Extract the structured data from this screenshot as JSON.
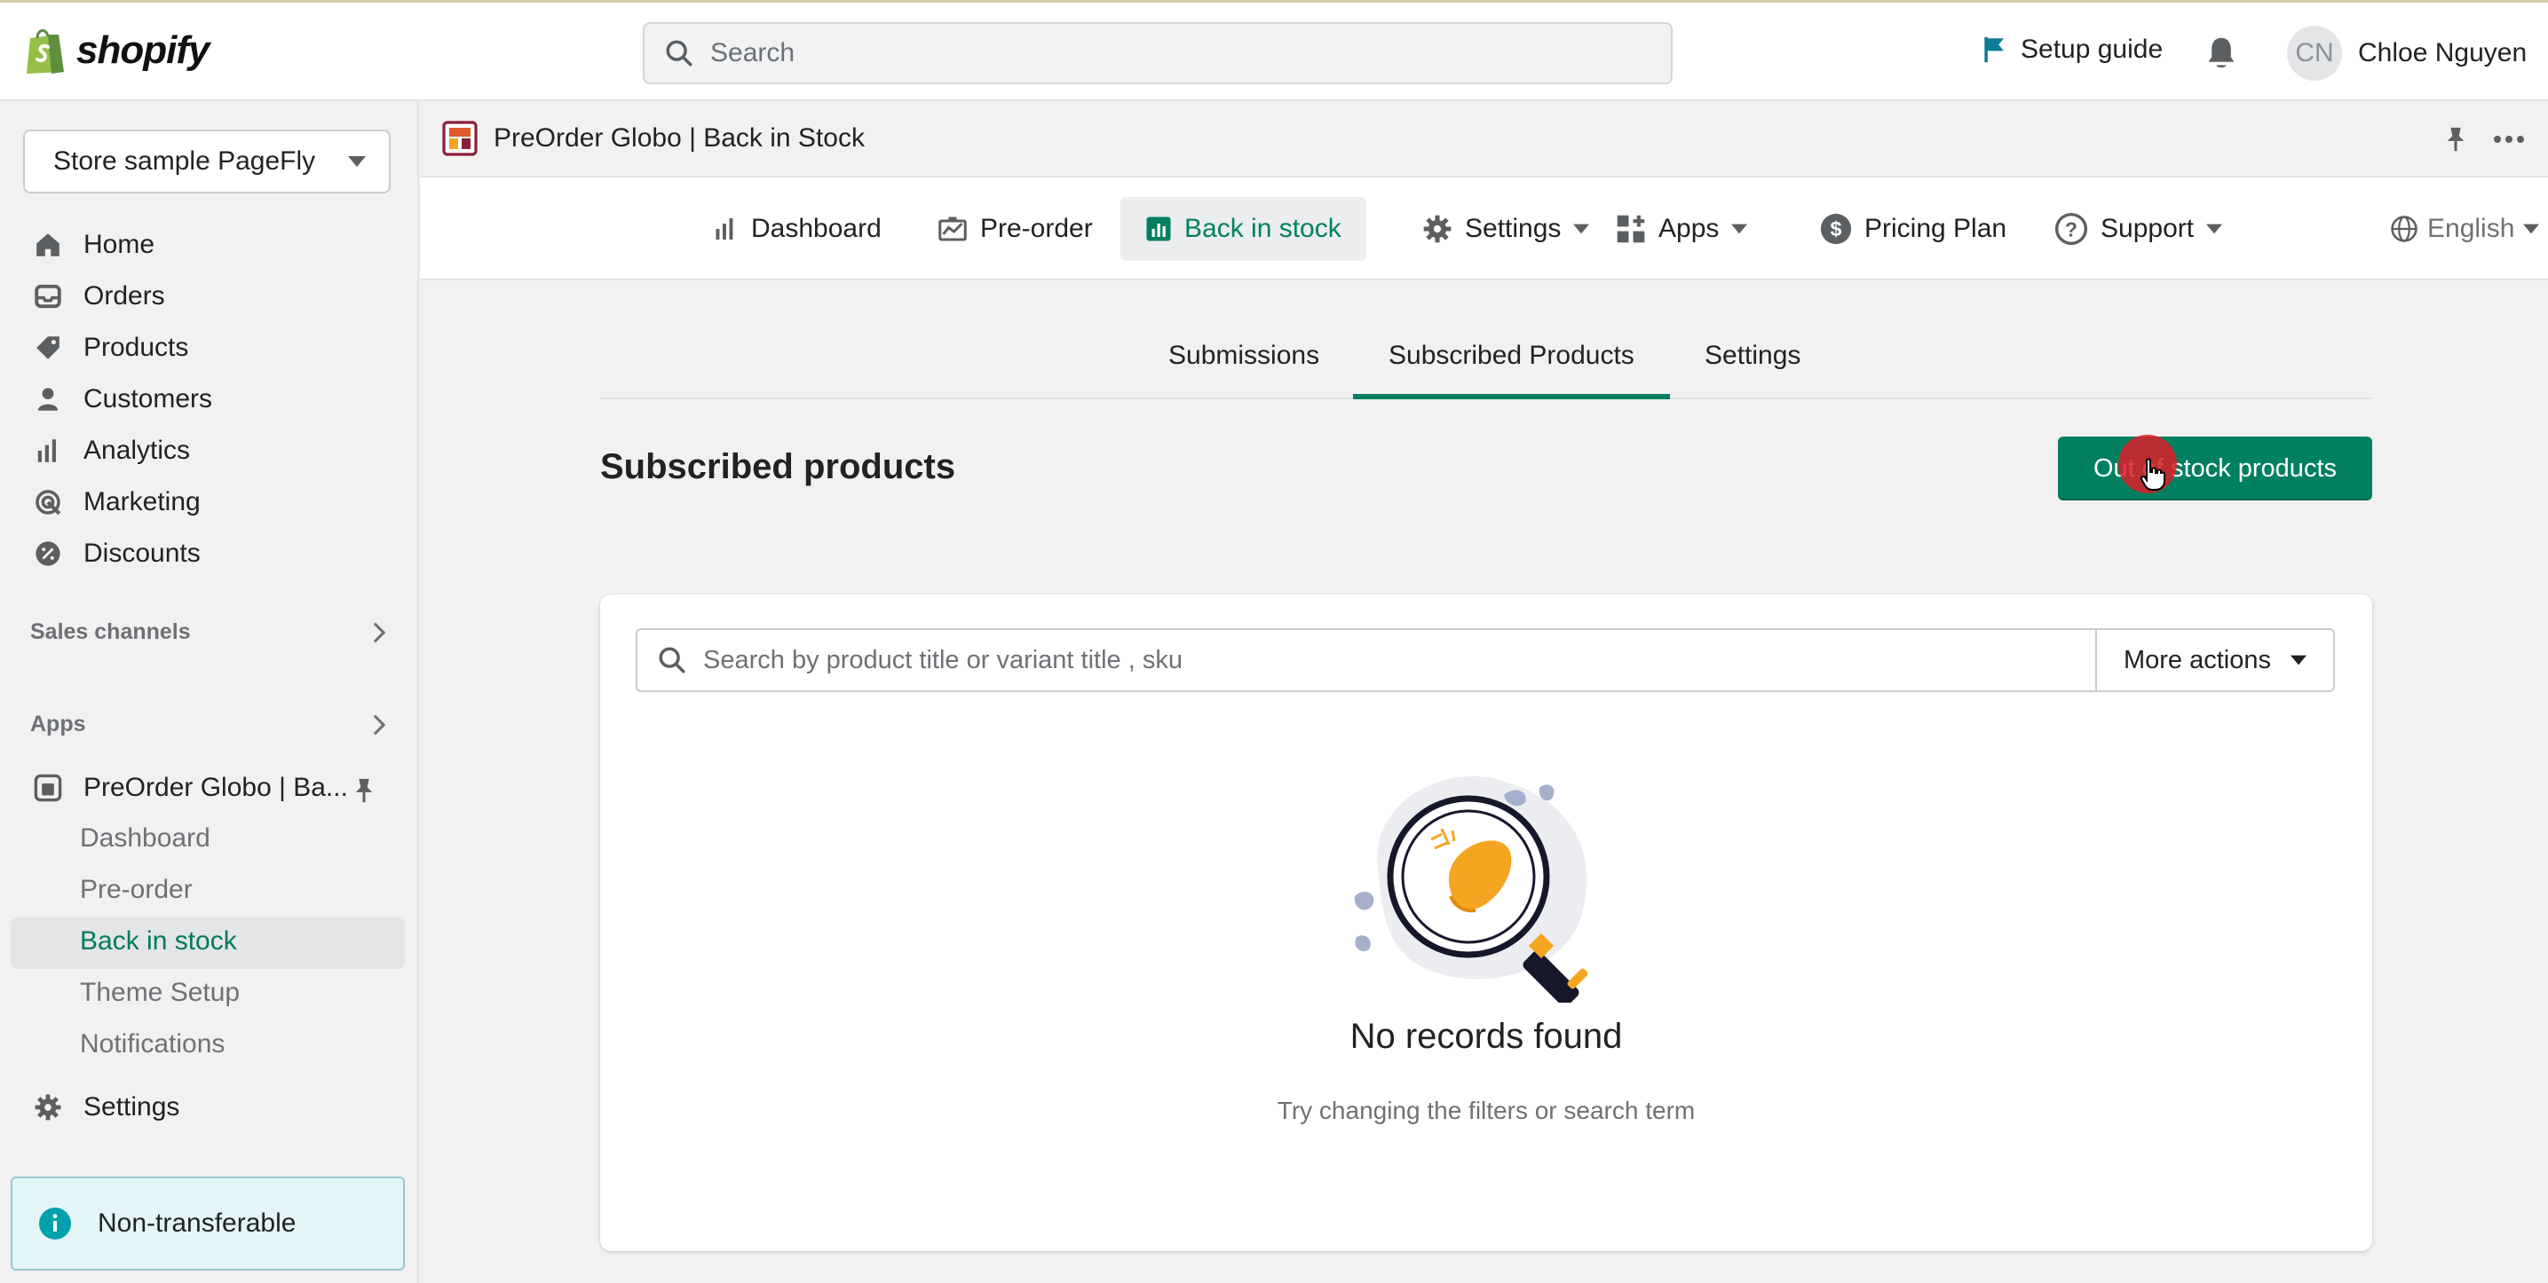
{
  "topbar": {
    "logo_text": "shopify",
    "search_placeholder": "Search",
    "setup_guide": "Setup guide",
    "avatar_initials": "CN",
    "user_name": "Chloe Nguyen"
  },
  "sidebar": {
    "store_name": "Store sample PageFly",
    "nav": [
      {
        "label": "Home",
        "icon": "home-icon"
      },
      {
        "label": "Orders",
        "icon": "inbox-icon"
      },
      {
        "label": "Products",
        "icon": "tag-icon"
      },
      {
        "label": "Customers",
        "icon": "person-icon"
      },
      {
        "label": "Analytics",
        "icon": "bar-chart-icon"
      },
      {
        "label": "Marketing",
        "icon": "target-icon"
      },
      {
        "label": "Discounts",
        "icon": "discount-icon"
      }
    ],
    "sales_channels": "Sales channels",
    "apps": "Apps",
    "app_name": "PreOrder Globo | Ba...",
    "app_sub_items": [
      "Dashboard",
      "Pre-order",
      "Back in stock",
      "Theme Setup",
      "Notifications"
    ],
    "settings": "Settings",
    "banner": "Non-transferable"
  },
  "app_header": {
    "title": "PreOrder Globo | Back in Stock"
  },
  "app_nav": {
    "tabs": [
      "Dashboard",
      "Pre-order",
      "Back in stock",
      "Settings",
      "Apps",
      "Pricing Plan",
      "Support"
    ],
    "language": "English"
  },
  "subtabs": [
    "Submissions",
    "Subscribed Products",
    "Settings"
  ],
  "page": {
    "heading": "Subscribed products",
    "primary_button": "Out of stock products",
    "search_placeholder": "Search by product title or variant title , sku",
    "more_actions": "More actions",
    "empty_title": "No records found",
    "empty_subtitle": "Try changing the filters or search term"
  },
  "colors": {
    "primary": "#008060",
    "text": "#202223",
    "subdued": "#6d7175",
    "click_indicator": "#dc1e28"
  }
}
